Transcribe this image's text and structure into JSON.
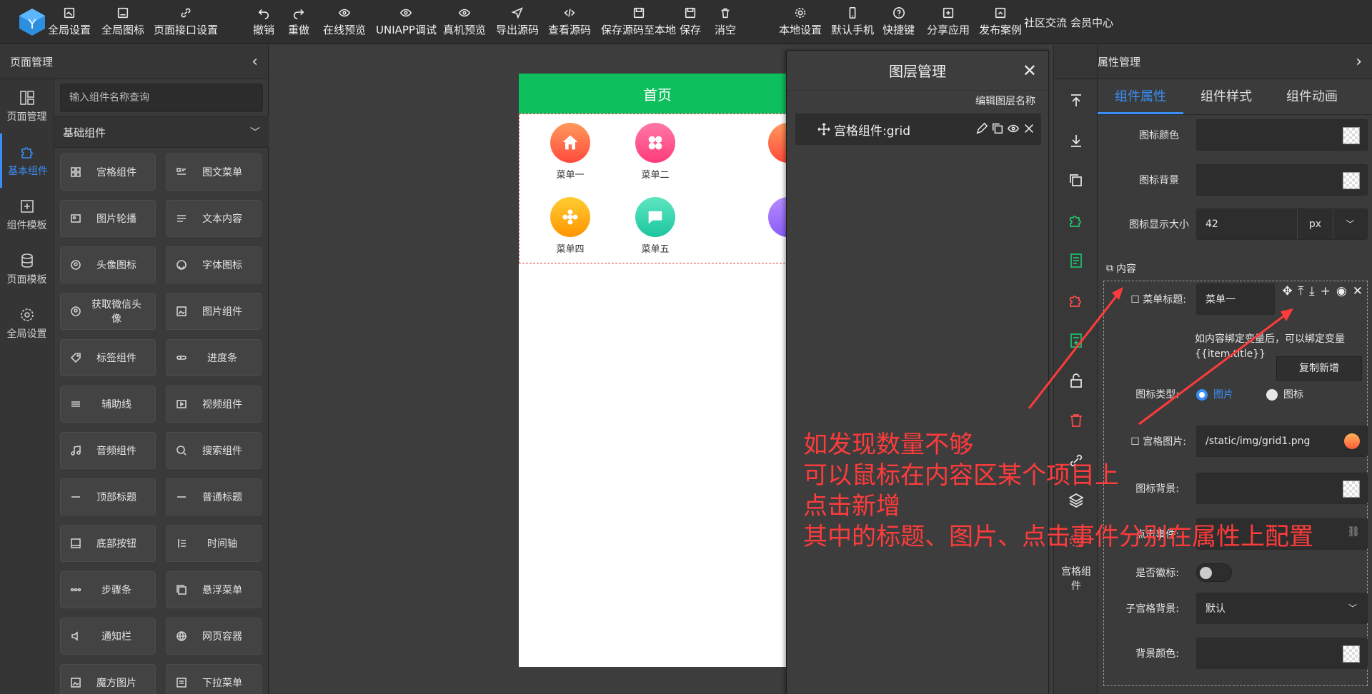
{
  "toolbar": {
    "items": [
      {
        "label": "全局设置",
        "icon": "settings-image-icon"
      },
      {
        "label": "全局图标",
        "icon": "image-icon"
      },
      {
        "label": "页面接口设置",
        "icon": "link-icon"
      },
      {
        "label": "撤销",
        "icon": "undo-icon"
      },
      {
        "label": "重做",
        "icon": "redo-icon"
      },
      {
        "label": "在线预览",
        "icon": "eye-icon"
      },
      {
        "label": "UNIAPP调试",
        "icon": "eye-icon"
      },
      {
        "label": "真机预览",
        "icon": "eye-icon"
      },
      {
        "label": "导出源码",
        "icon": "send-icon"
      },
      {
        "label": "查看源码",
        "icon": "code-icon"
      },
      {
        "label": "保存源码至本地",
        "icon": "save-icon"
      },
      {
        "label": "保存",
        "icon": "save-icon"
      },
      {
        "label": "消空",
        "icon": "trash-icon"
      },
      {
        "label": "本地设置",
        "icon": "gear-icon"
      },
      {
        "label": "默认手机",
        "icon": "phone-icon"
      },
      {
        "label": "快捷键",
        "icon": "help-icon"
      },
      {
        "label": "分享应用",
        "icon": "share-icon"
      },
      {
        "label": "发布案例",
        "icon": "publish-icon"
      }
    ],
    "community": "社区交流",
    "member": "会员中心"
  },
  "left": {
    "title": "页面管理",
    "rail": [
      {
        "label": "页面管理",
        "icon": "layout-icon"
      },
      {
        "label": "基本组件",
        "icon": "puzzle-icon",
        "active": true
      },
      {
        "label": "组件模板",
        "icon": "template-icon"
      },
      {
        "label": "页面模板",
        "icon": "database-icon"
      },
      {
        "label": "全局设置",
        "icon": "gear-icon"
      }
    ],
    "search_placeholder": "输入组件名称查询",
    "group": "基础组件",
    "components": [
      "宫格组件",
      "图文菜单",
      "图片轮播",
      "文本内容",
      "头像图标",
      "字体图标",
      "获取微信头像",
      "图片组件",
      "标签组件",
      "进度条",
      "辅助线",
      "视频组件",
      "音频组件",
      "搜索组件",
      "顶部标题",
      "普通标题",
      "底部按钮",
      "时间轴",
      "步骤条",
      "悬浮菜单",
      "通知栏",
      "网页容器",
      "魔方图片",
      "下拉菜单"
    ],
    "component_icons": [
      "grid-icon",
      "list-icon",
      "carousel-icon",
      "text-icon",
      "avatar-icon",
      "smile-icon",
      "wechat-avatar-icon",
      "picture-icon",
      "tag-icon",
      "progress-icon",
      "divider-icon",
      "video-icon",
      "music-icon",
      "search-icon",
      "title-icon",
      "title-icon",
      "bottom-button-icon",
      "timeline-icon",
      "steps-icon",
      "float-menu-icon",
      "notice-icon",
      "globe-icon",
      "cube-image-icon",
      "dropdown-icon"
    ]
  },
  "phone": {
    "title": "首页",
    "items": [
      {
        "label": "菜单一",
        "color": "#ff6a3d",
        "icon": "home-icon"
      },
      {
        "label": "菜单二",
        "color": "#ff4d8d",
        "icon": "clover-icon"
      },
      {
        "label": "菜单四",
        "color": "#ffb300",
        "icon": "flower-icon"
      },
      {
        "label": "菜单五",
        "color": "#2ed3a8",
        "icon": "chat-icon"
      }
    ]
  },
  "layer": {
    "title": "图层管理",
    "edit_name": "编辑图层名称",
    "row": "宫格组件:grid"
  },
  "strip": {
    "label": "宫格组件"
  },
  "props": {
    "title": "属性管理",
    "tabs": [
      "组件属性",
      "组件样式",
      "组件动画"
    ],
    "icon_color": "图标颜色",
    "icon_bg": "图标背景",
    "icon_size": "图标显示大小",
    "icon_size_value": "42",
    "icon_size_unit": "px",
    "content": "内容",
    "menu_title_label": "菜单标题:",
    "menu_title_value": "菜单一",
    "hint": "如内容绑定变量后，可以绑定变量{{item.title}}",
    "copy_add": "复制新增",
    "icon_type_label": "图标类型:",
    "icon_type_image": "图片",
    "icon_type_icon": "图标",
    "grid_image_label": "宫格图片:",
    "grid_image_value": "/static/img/grid1.png",
    "icon_bg2_label": "图标背景:",
    "click_label": "点击事件:",
    "badge_label": "是否徽标:",
    "sub_bg_label": "子宫格背景:",
    "sub_bg_value": "默认",
    "bg_color_label": "背景颜色:"
  },
  "annotation": {
    "lines": [
      "如发现数量不够",
      "可以鼠标在内容区某个项目上",
      "点击新增",
      "其中的标题、图片、点击事件分别在属性上配置"
    ]
  },
  "colors": {
    "accent": "#3a8ef6",
    "header_green": "#0ec05d",
    "annotation": "#ff3b3b"
  }
}
